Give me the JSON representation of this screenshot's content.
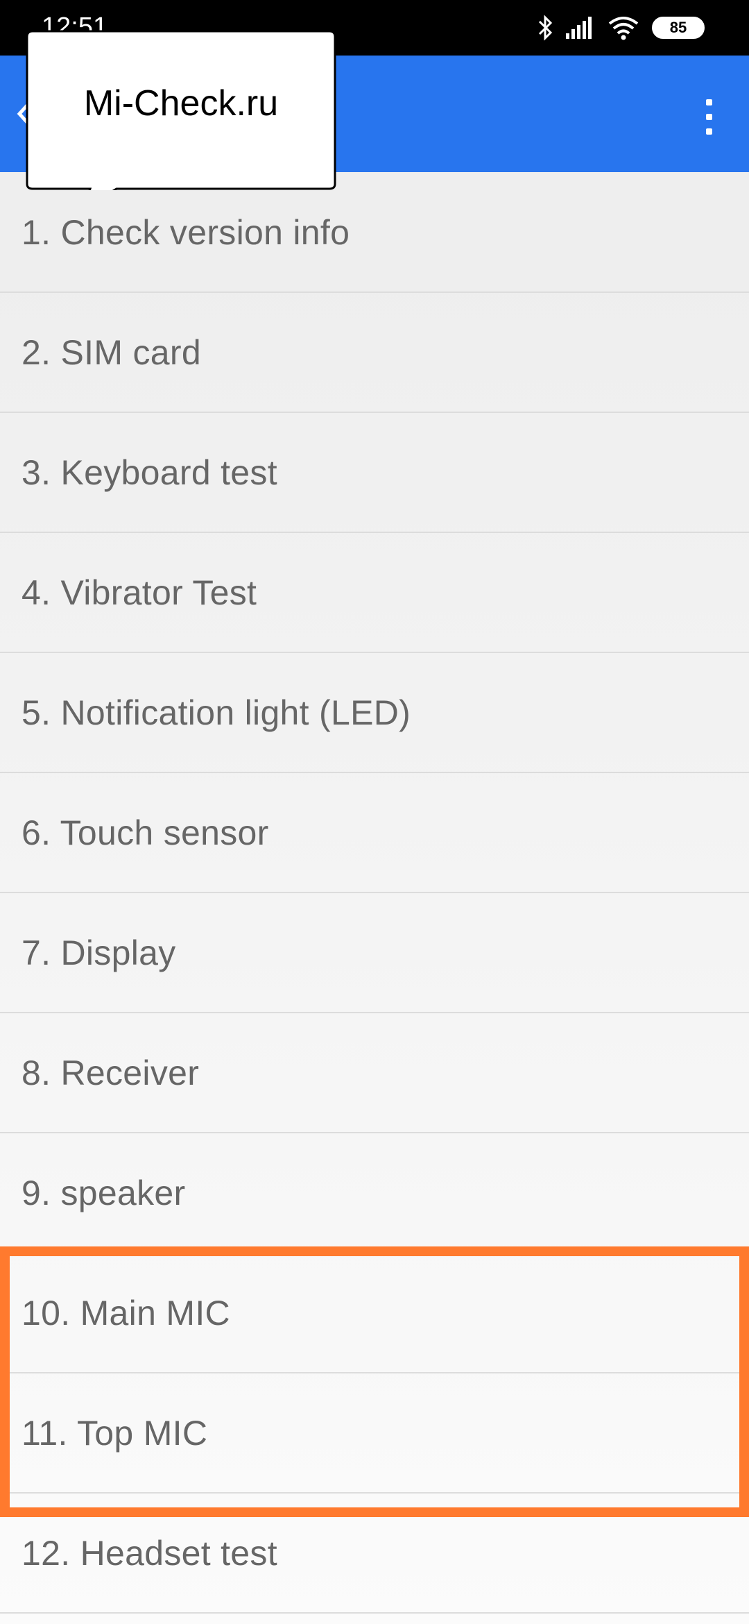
{
  "status_bar": {
    "time": "12:51",
    "battery": "85",
    "icons": [
      "bluetooth-icon",
      "signal-icon",
      "wifi-icon",
      "battery-icon"
    ]
  },
  "app_bar": {
    "color": "#2875ee",
    "back_icon": "back-arrow-icon",
    "menu_icon": "overflow-menu-icon"
  },
  "tests": [
    {
      "label": "1. Check version info"
    },
    {
      "label": "2. SIM card"
    },
    {
      "label": "3. Keyboard test"
    },
    {
      "label": "4. Vibrator Test"
    },
    {
      "label": "5. Notification light (LED)"
    },
    {
      "label": "6. Touch sensor"
    },
    {
      "label": "7. Display"
    },
    {
      "label": "8. Receiver"
    },
    {
      "label": "9. speaker"
    },
    {
      "label": "10. Main MIC"
    },
    {
      "label": "11. Top MIC"
    },
    {
      "label": "12. Headset test"
    }
  ],
  "highlight": {
    "color": "#ff7a2e",
    "covers": [
      "10. Main MIC",
      "11. Top MIC"
    ]
  },
  "watermark": {
    "text": "Mi-Check.ru"
  }
}
